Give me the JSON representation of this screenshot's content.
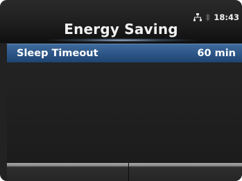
{
  "header": {
    "title": "Energy Saving",
    "clock": "18:43",
    "icons": [
      "network-icon",
      "bluetooth-icon"
    ]
  },
  "menu": {
    "items": [
      {
        "label": "Sleep Timeout",
        "value": "60 min",
        "selected": true
      }
    ]
  },
  "softkeys": [
    {
      "label": ""
    },
    {
      "label": ""
    }
  ],
  "colors": {
    "background": "#222222",
    "selection": "#2b5586",
    "text": "#ffffff"
  }
}
